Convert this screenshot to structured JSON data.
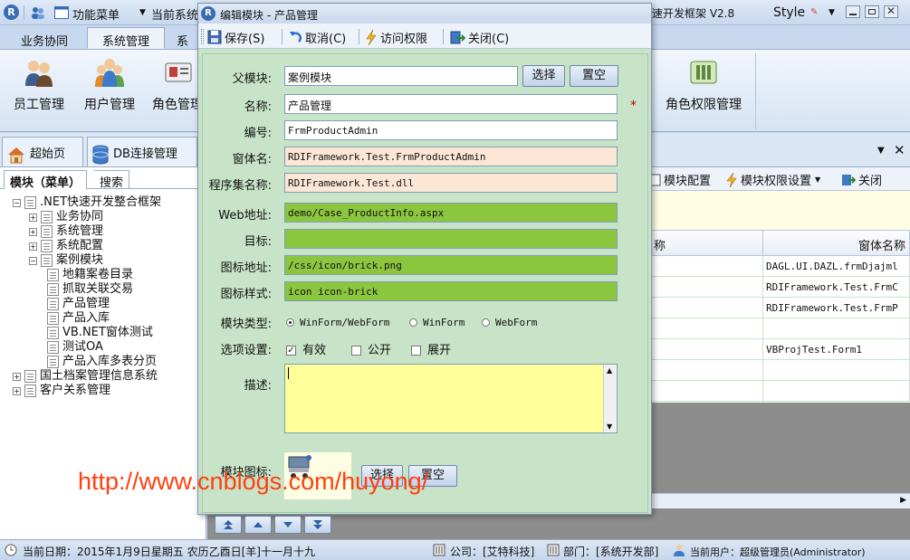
{
  "window": {
    "menu_label": "功能菜单",
    "current_system_label": "当前系统",
    "app_title_fragment": "速开发框架 V2.8",
    "style_label": "Style"
  },
  "main_tabs": [
    {
      "label": "业务协同",
      "active": false
    },
    {
      "label": "系统管理",
      "active": true
    },
    {
      "label": "系",
      "active": false
    }
  ],
  "ribbon": {
    "items": [
      {
        "label": "员工管理"
      },
      {
        "label": "用户管理"
      },
      {
        "label": "角色管理"
      },
      {
        "label": "角色权限管理"
      }
    ]
  },
  "doc_tabs": [
    {
      "label": "超始页"
    },
    {
      "label": "DB连接管理"
    }
  ],
  "left_pane": {
    "tabs": [
      "模块（菜单）",
      "搜索"
    ],
    "tree": [
      {
        "label": ".NET快速开发整合框架",
        "level": 0,
        "expander": "−"
      },
      {
        "label": "业务协同",
        "level": 1,
        "expander": "+"
      },
      {
        "label": "系统管理",
        "level": 1,
        "expander": "+"
      },
      {
        "label": "系统配置",
        "level": 1,
        "expander": "+"
      },
      {
        "label": "案例模块",
        "level": 1,
        "expander": "−"
      },
      {
        "label": "地籍案卷目录",
        "level": 2,
        "expander": ""
      },
      {
        "label": "抓取关联交易",
        "level": 2,
        "expander": ""
      },
      {
        "label": "产品管理",
        "level": 2,
        "expander": ""
      },
      {
        "label": "产品入库",
        "level": 2,
        "expander": ""
      },
      {
        "label": "VB.NET窗体测试",
        "level": 2,
        "expander": ""
      },
      {
        "label": "测试OA",
        "level": 2,
        "expander": ""
      },
      {
        "label": "产品入库多表分页",
        "level": 2,
        "expander": ""
      },
      {
        "label": "国土档案管理信息系统",
        "level": 0,
        "expander": "+"
      },
      {
        "label": "客户关系管理",
        "level": 0,
        "expander": "+"
      }
    ]
  },
  "right_toolbar": {
    "module_config": "模块配置",
    "module_permission": "模块权限设置",
    "close": "关闭"
  },
  "grid": {
    "headers": [
      "称",
      "窗体名称"
    ],
    "rows": [
      [
        "",
        "DAGL.UI.DAZL.frmDjajml"
      ],
      [
        "",
        "RDIFramework.Test.FrmC"
      ],
      [
        "",
        "RDIFramework.Test.FrmP"
      ],
      [
        "",
        ""
      ],
      [
        "",
        "VBProjTest.Form1"
      ],
      [
        "",
        ""
      ],
      [
        "",
        ""
      ]
    ]
  },
  "dialog": {
    "title": "编辑模块 - 产品管理",
    "toolbar": {
      "save": "保存(S)",
      "cancel": "取消(C)",
      "access": "访问权限",
      "close": "关闭(C)"
    },
    "fields": {
      "parent_label": "父模块:",
      "parent_value": "案例模块",
      "select_button": "选择",
      "clear_button": "置空",
      "name_label": "名称:",
      "name_value": "产品管理",
      "required_mark": "*",
      "code_label": "编号:",
      "code_value": "FrmProductAdmin",
      "form_label": "窗体名:",
      "form_value": "RDIFramework.Test.FrmProductAdmin",
      "assembly_label": "程序集名称:",
      "assembly_value": "RDIFramework.Test.dll",
      "web_label": "Web地址:",
      "web_value": "demo/Case_ProductInfo.aspx",
      "target_label": "目标:",
      "target_value": "",
      "icon_url_label": "图标地址:",
      "icon_url_value": "/css/icon/brick.png",
      "icon_style_label": "图标样式:",
      "icon_style_value": "icon icon-brick",
      "type_label": "模块类型:",
      "type_options": [
        "WinForm/WebForm",
        "WinForm",
        "WebForm"
      ],
      "type_selected": 0,
      "options_label": "选项设置:",
      "option_enabled": "有效",
      "option_public": "公开",
      "option_expand": "展开",
      "option_enabled_checked": true,
      "desc_label": "描述:",
      "module_icon_label": "模块图标:",
      "icon_select_button": "选择",
      "icon_clear_button": "置空"
    }
  },
  "status": {
    "date": "当前日期：2015年1月9日星期五 农历乙酉日[羊]十一月十九",
    "company": "公司：[艾特科技]",
    "department": "部门：[系统开发部]",
    "user": "当前用户：超级管理员(Administrator)"
  },
  "watermark": "http://www.cnblogs.com/huyong/",
  "colors": {
    "dialog_bg": "#c8e4c8",
    "readonly_field": "#fce7d7",
    "web_field": "#8cc63f",
    "description_bg": "#ffff99",
    "required": "#cc0000",
    "watermark": "#ff4010"
  }
}
